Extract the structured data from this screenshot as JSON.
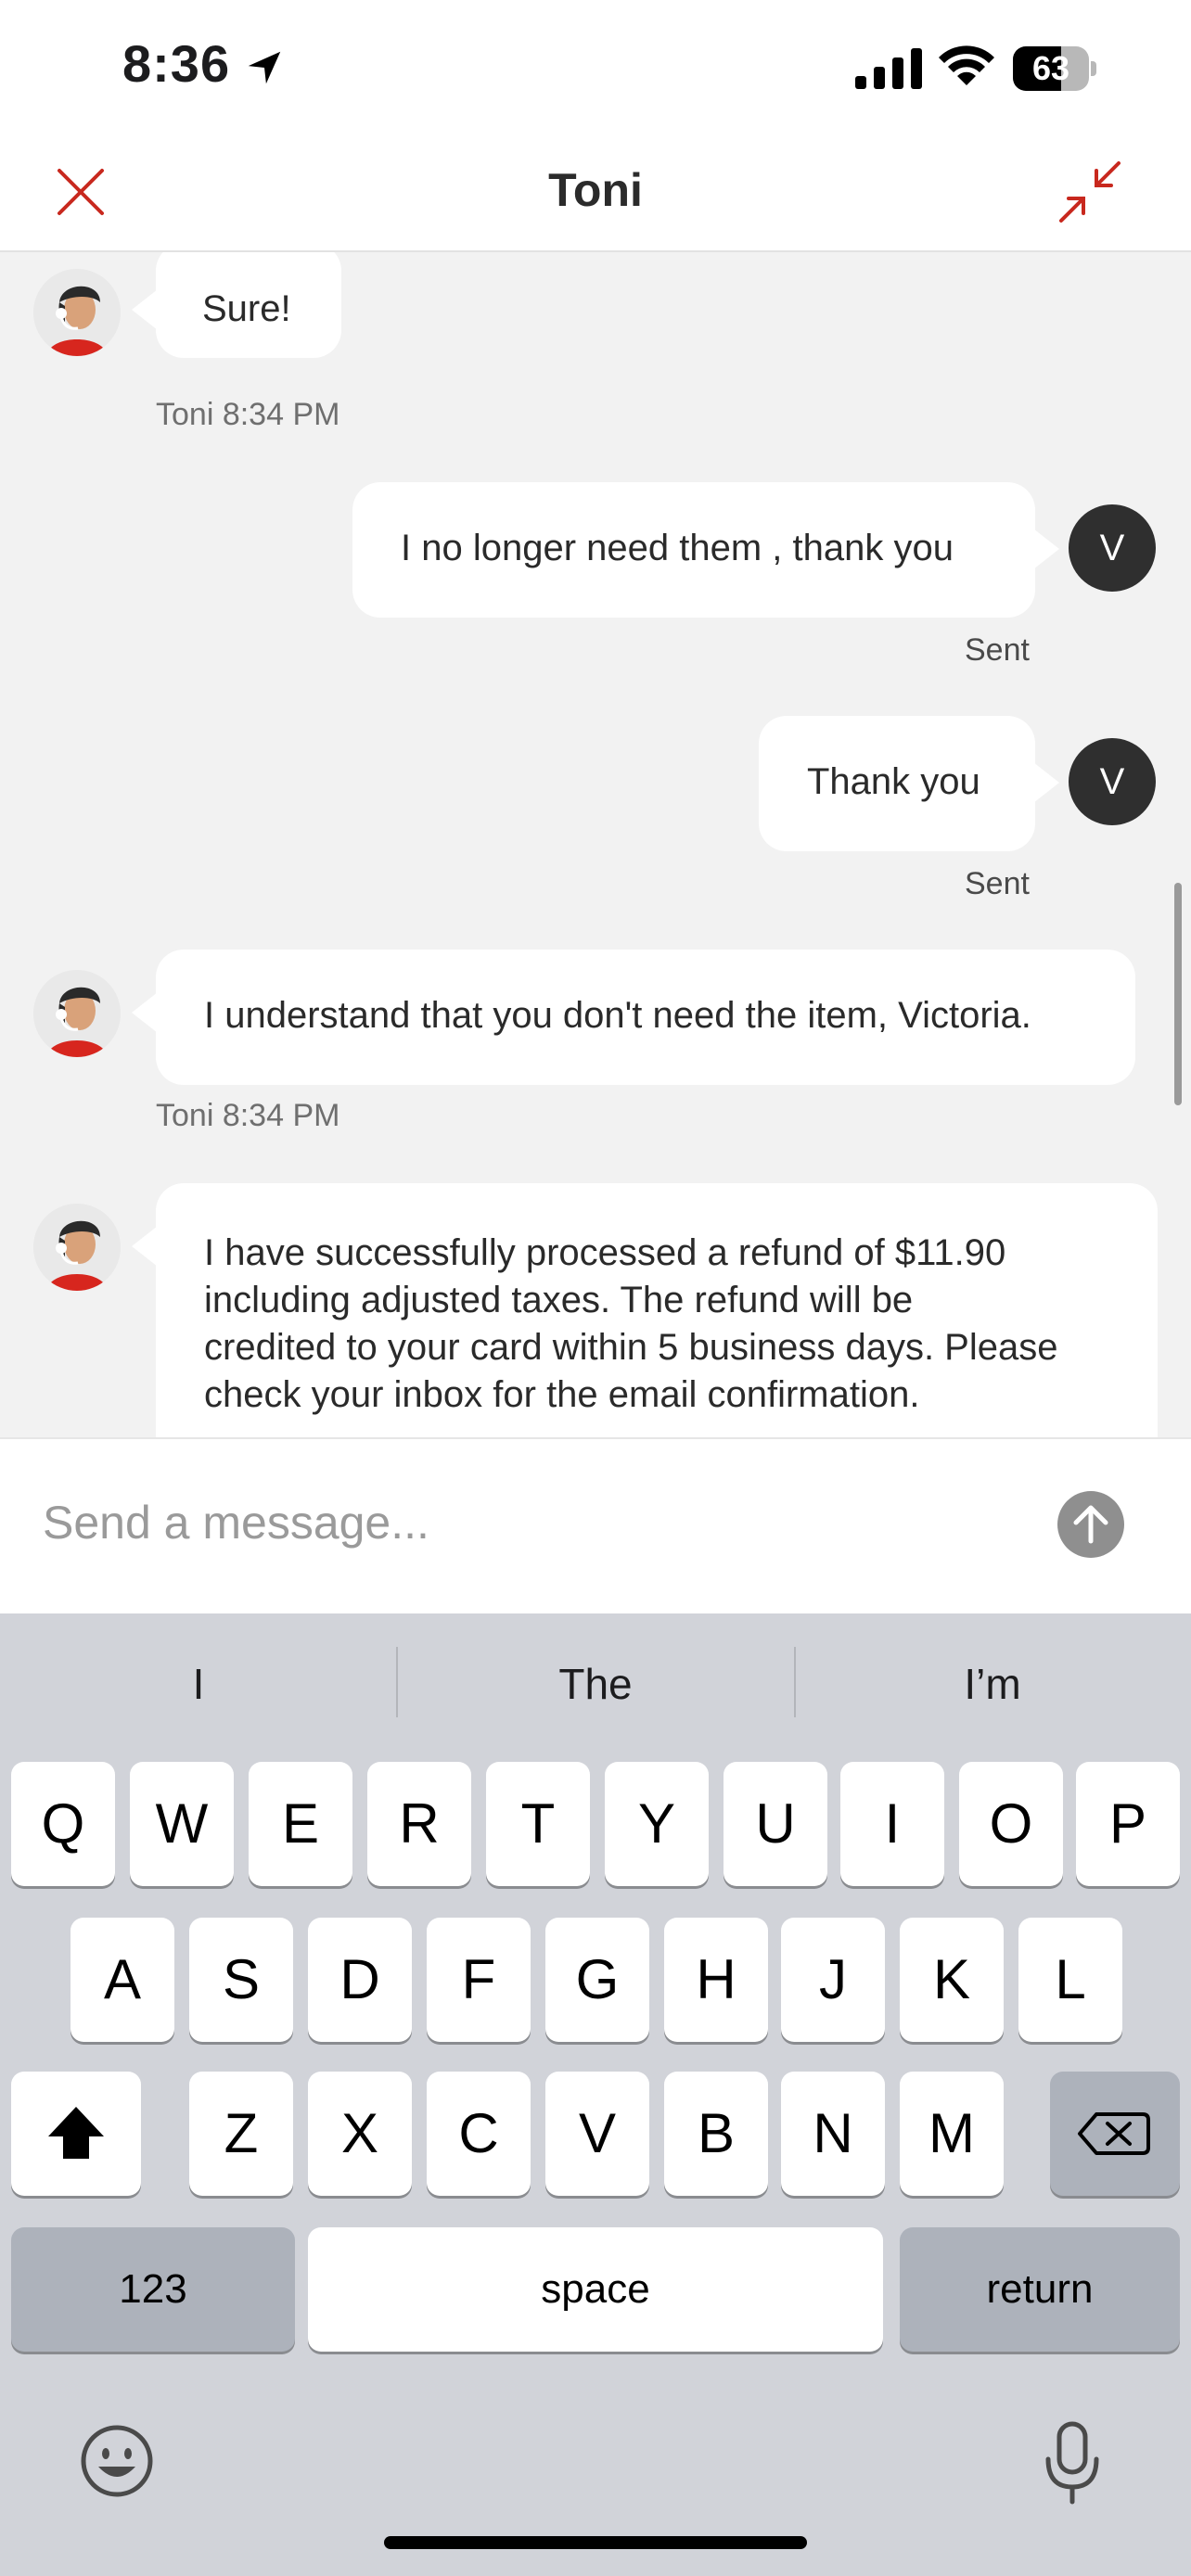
{
  "status_bar": {
    "time": "8:36",
    "battery": "63",
    "battery_level": 0.63
  },
  "header": {
    "title": "Toni"
  },
  "messages": [
    {
      "from": "agent",
      "text": "Sure!",
      "meta": "Toni 8:34 PM"
    },
    {
      "from": "user",
      "avatar": "V",
      "text": "I no longer need them , thank you",
      "meta": "Sent"
    },
    {
      "from": "user",
      "avatar": "V",
      "text": "Thank you",
      "meta": "Sent"
    },
    {
      "from": "agent",
      "text": "I understand that you don't need the item, Victoria.",
      "meta": "Toni 8:34 PM"
    },
    {
      "from": "agent",
      "lines": [
        "I have successfully processed a refund of $11.90",
        "including adjusted taxes. The refund will be",
        "credited to your card within 5 business days. Please",
        "check your inbox for the email confirmation."
      ]
    }
  ],
  "composer": {
    "placeholder": "Send a message..."
  },
  "keyboard": {
    "suggestions": [
      "I",
      "The",
      "I’m"
    ],
    "row1": [
      "Q",
      "W",
      "E",
      "R",
      "T",
      "Y",
      "U",
      "I",
      "O",
      "P"
    ],
    "row2": [
      "A",
      "S",
      "D",
      "F",
      "G",
      "H",
      "J",
      "K",
      "L"
    ],
    "row3": [
      "Z",
      "X",
      "C",
      "V",
      "B",
      "N",
      "M"
    ],
    "numbers_key": "123",
    "space_key": "space",
    "return_key": "return"
  },
  "icons": {
    "close": "close-icon",
    "minimize": "minimize-icon",
    "send": "arrow-up-icon",
    "shift": "shift-icon",
    "backspace": "backspace-icon",
    "emoji": "emoji-icon",
    "mic": "microphone-icon"
  },
  "colors": {
    "accent": "#c8281e",
    "user_avatar": "#2f2f2f",
    "send_button": "#8f8f8f"
  }
}
